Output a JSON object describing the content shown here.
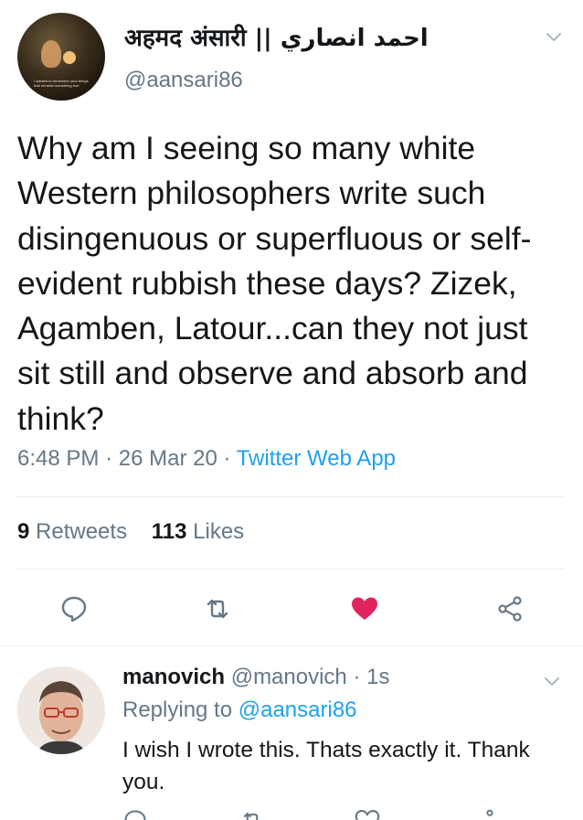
{
  "tweet": {
    "display_name": "अहमद अंसारी || احمد انصاري",
    "handle": "@aansari86",
    "avatar_caption": "I wanted to remember your things that remains something true",
    "text": "Why am I seeing so many white Western philosophers write such disingenuous or superfluous or self-evident rubbish these days? Zizek, Agamben, Latour...can they not just sit still and observe and absorb and think?",
    "time": "6:48 PM",
    "date": "26 Mar 20",
    "source": "Twitter Web App",
    "separator": "·",
    "retweets_count": "9",
    "retweets_label": "Retweets",
    "likes_count": "113",
    "likes_label": "Likes",
    "liked": true
  },
  "reply": {
    "name": "manovich",
    "handle": "@manovich",
    "separator": "·",
    "time": "1s",
    "replying_prefix": "Replying to",
    "replying_to": "@aansari86",
    "text": "I wish I wrote this. Thats exactly it. Thank you."
  },
  "icons": {
    "chevron": "chevron-down-icon",
    "reply": "reply-icon",
    "retweet": "retweet-icon",
    "like": "heart-icon",
    "share": "share-icon"
  },
  "colors": {
    "text": "#14171a",
    "secondary": "#657786",
    "link": "#1da1f2",
    "like": "#e0245e",
    "divider": "#e6ecf0"
  }
}
